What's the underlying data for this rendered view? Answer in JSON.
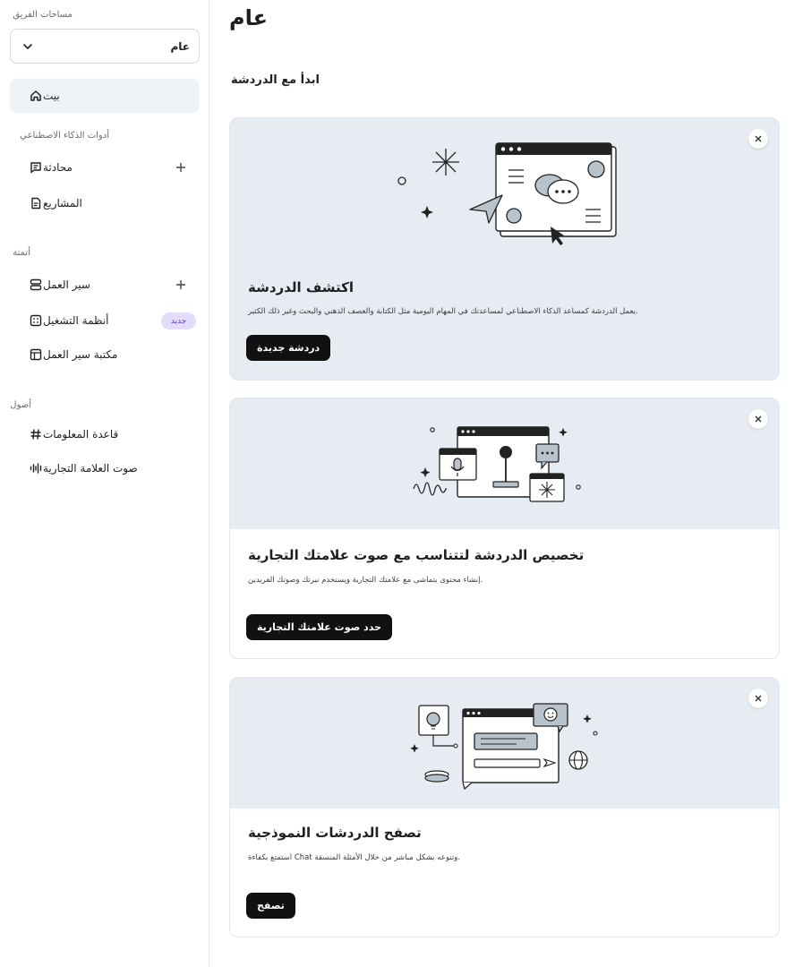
{
  "sidebar": {
    "workspace_label": "مساحات الفريق",
    "workspace_selected": "عام",
    "home_label": "بيت",
    "ai_tools_label": "أدوات الذكاء الاصطناعي",
    "chat_label": "محادثة",
    "projects_label": "المشاريع",
    "automation_label": "أتمتة",
    "workflows_label": "سير العمل",
    "os_label": "أنظمة التشغيل",
    "new_badge": "جديد",
    "workflow_library_label": "مكتبة سير العمل",
    "assets_label": "أصول",
    "knowledge_base_label": "قاعدة المعلومات",
    "brand_voice_label": "صوت العلامة التجارية"
  },
  "main": {
    "page_title": "عام",
    "section_heading": "ابدأ مع الدردشة",
    "cards": [
      {
        "title": "اكتشف الدردشة",
        "description": ".يعمل الدردشة كمساعد الذكاء الاصطناعي لمساعدتك في المهام اليومية مثل الكتابة والعصف الذهني والبحث وغير ذلك الكثير",
        "button": "دردشة جديدة"
      },
      {
        "title": "تخصيص الدردشة لتتناسب مع صوت علامتك التجارية",
        "description": ".إنشاء محتوى يتماشى مع علامتك التجارية ويستخدم نبرتك وصوتك الفريدين",
        "button": "حدد صوت علامتك التجارية"
      },
      {
        "title": "تصفح الدردشات النموذجية",
        "description": ".وتنوعه بشكل مباشر من خلال الأمثلة المنسقة Chat استمتع بكفاءة",
        "button": "تصفح"
      }
    ]
  },
  "colors": {
    "illustration_bg": "#e6ecf1",
    "button_bg": "#111111",
    "badge_bg": "#e4dcfa",
    "badge_text": "#5b3fc4",
    "sidebar_active_bg": "#f0f3f6"
  },
  "icons": [
    "chevron-down-icon",
    "home-icon",
    "chat-icon",
    "document-icon",
    "plus-icon",
    "workflow-icon",
    "os-icon",
    "library-icon",
    "hash-icon",
    "soundwave-icon",
    "close-icon"
  ]
}
